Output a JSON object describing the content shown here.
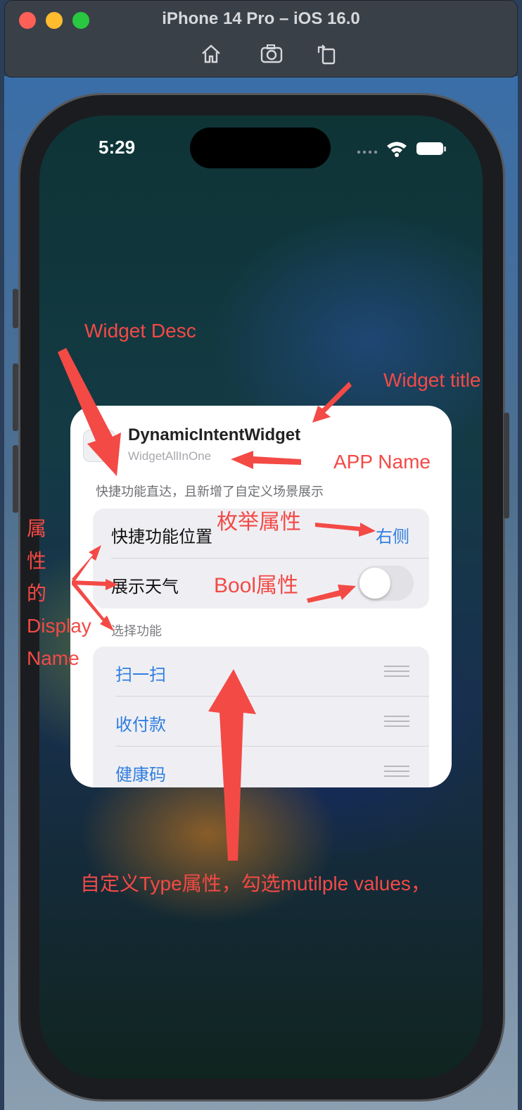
{
  "window": {
    "title": "iPhone 14 Pro – iOS 16.0",
    "toolbar": [
      "home-icon",
      "screenshot-icon",
      "rotate-icon"
    ],
    "traffic_light_colors": [
      "#fe5f57",
      "#febc2e",
      "#28c840"
    ]
  },
  "status_bar": {
    "time": "5:29"
  },
  "widget": {
    "title": "DynamicIntentWidget",
    "app_name": "WidgetAllInOne",
    "description": "快捷功能直达，且新增了自定义场景展示",
    "settings": [
      {
        "label": "快捷功能位置",
        "value": "右侧"
      },
      {
        "label": "展示天气",
        "toggle_on": false
      }
    ],
    "section_header": "选择功能",
    "functions": [
      "扫一扫",
      "收付款",
      "健康码"
    ]
  },
  "annotations": {
    "widget_desc": "Widget Desc",
    "widget_title": "Widget title",
    "app_name": "APP Name",
    "enum_attr": "枚举属性",
    "bool_attr": "Bool属性",
    "display_name": [
      "属",
      "性",
      "的",
      "Display",
      "Name"
    ],
    "custom_type": "自定义Type属性，勾选mutilple values，"
  },
  "colors": {
    "annotation": "#f34a46",
    "accent": "#2f7de1"
  }
}
